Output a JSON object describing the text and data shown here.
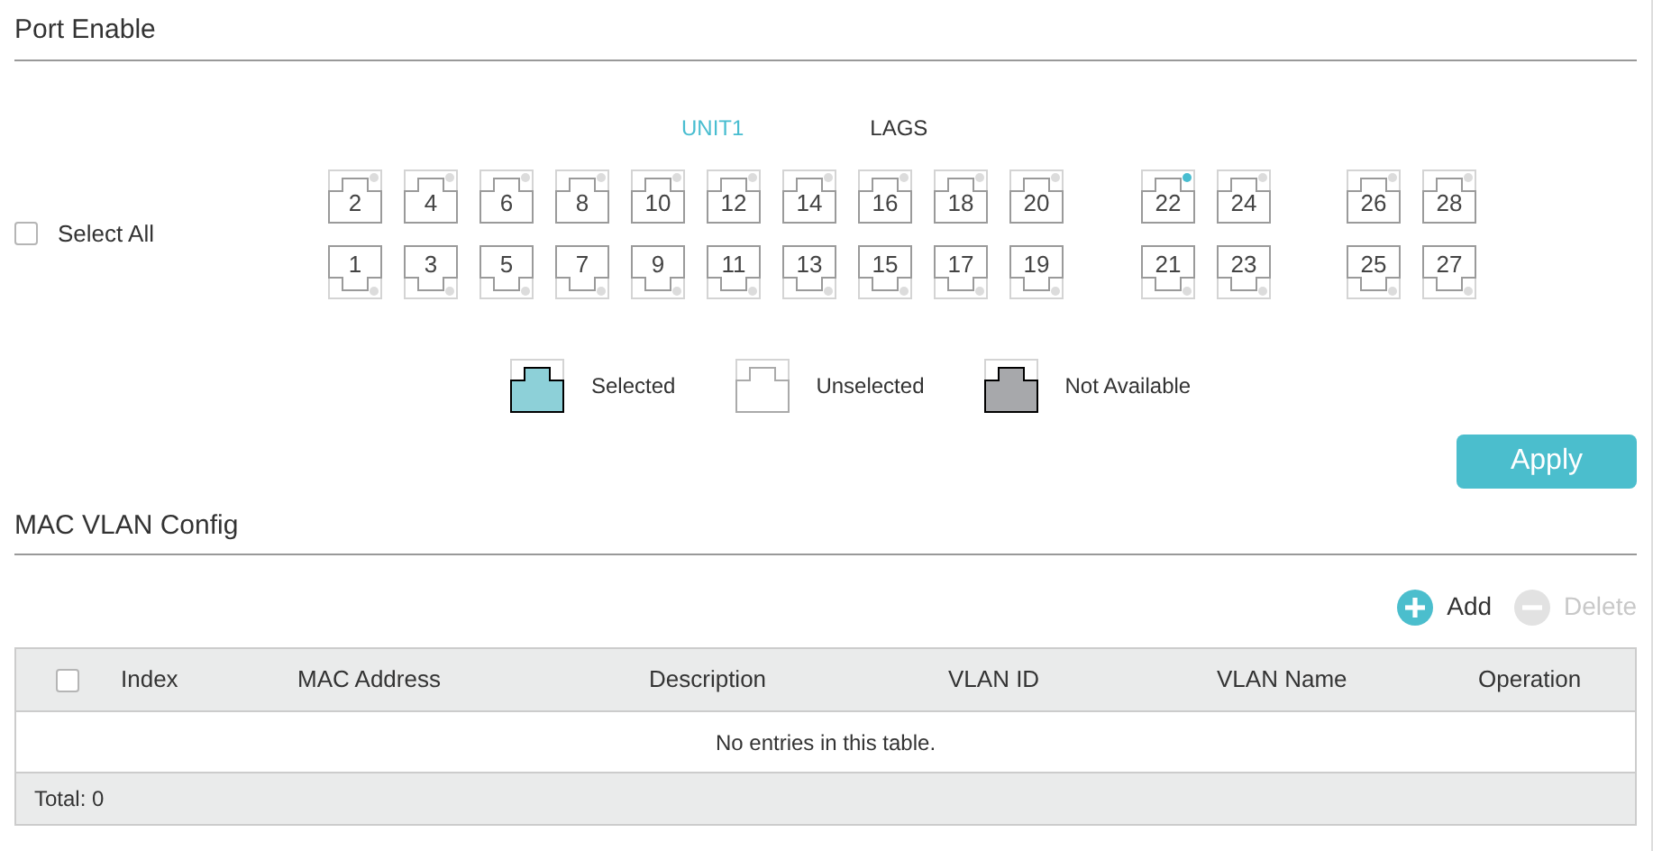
{
  "port_section": {
    "title": "Port Enable",
    "tabs": [
      {
        "label": "UNIT1",
        "selected": true
      },
      {
        "label": "LAGS",
        "selected": false
      }
    ],
    "select_all": {
      "label": "Select All",
      "checked": false
    },
    "port_groups": [
      {
        "top": [
          {
            "label": "2",
            "linked": false,
            "selected": false
          },
          {
            "label": "4",
            "linked": false,
            "selected": false
          },
          {
            "label": "6",
            "linked": false,
            "selected": false
          },
          {
            "label": "8",
            "linked": false,
            "selected": false
          },
          {
            "label": "10",
            "linked": false,
            "selected": false
          },
          {
            "label": "12",
            "linked": false,
            "selected": false
          },
          {
            "label": "14",
            "linked": false,
            "selected": false
          },
          {
            "label": "16",
            "linked": false,
            "selected": false
          },
          {
            "label": "18",
            "linked": false,
            "selected": false
          },
          {
            "label": "20",
            "linked": false,
            "selected": false
          }
        ],
        "bottom": [
          {
            "label": "1",
            "linked": false,
            "selected": false
          },
          {
            "label": "3",
            "linked": false,
            "selected": false
          },
          {
            "label": "5",
            "linked": false,
            "selected": false
          },
          {
            "label": "7",
            "linked": false,
            "selected": false
          },
          {
            "label": "9",
            "linked": false,
            "selected": false
          },
          {
            "label": "11",
            "linked": false,
            "selected": false
          },
          {
            "label": "13",
            "linked": false,
            "selected": false
          },
          {
            "label": "15",
            "linked": false,
            "selected": false
          },
          {
            "label": "17",
            "linked": false,
            "selected": false
          },
          {
            "label": "19",
            "linked": false,
            "selected": false
          }
        ]
      },
      {
        "top": [
          {
            "label": "22",
            "linked": true,
            "selected": false
          },
          {
            "label": "24",
            "linked": false,
            "selected": false
          }
        ],
        "bottom": [
          {
            "label": "21",
            "linked": false,
            "selected": false
          },
          {
            "label": "23",
            "linked": false,
            "selected": false
          }
        ]
      },
      {
        "top": [
          {
            "label": "26",
            "linked": false,
            "selected": false
          },
          {
            "label": "28",
            "linked": false,
            "selected": false
          }
        ],
        "bottom": [
          {
            "label": "25",
            "linked": false,
            "selected": false
          },
          {
            "label": "27",
            "linked": false,
            "selected": false
          }
        ]
      }
    ],
    "legend": [
      {
        "kind": "selected",
        "label": "Selected"
      },
      {
        "kind": "unselected",
        "label": "Unselected"
      },
      {
        "kind": "unavailable",
        "label": "Not Available"
      }
    ],
    "apply_button": "Apply"
  },
  "mac_vlan_section": {
    "title": "MAC VLAN Config",
    "actions": [
      {
        "kind": "add",
        "label": "Add",
        "disabled": false
      },
      {
        "kind": "delete",
        "label": "Delete",
        "disabled": true
      }
    ],
    "table": {
      "select_all_checked": false,
      "columns": [
        "Index",
        "MAC Address",
        "Description",
        "VLAN ID",
        "VLAN Name",
        "Operation"
      ],
      "empty_message": "No entries in this table.",
      "footer": "Total: 0"
    }
  }
}
